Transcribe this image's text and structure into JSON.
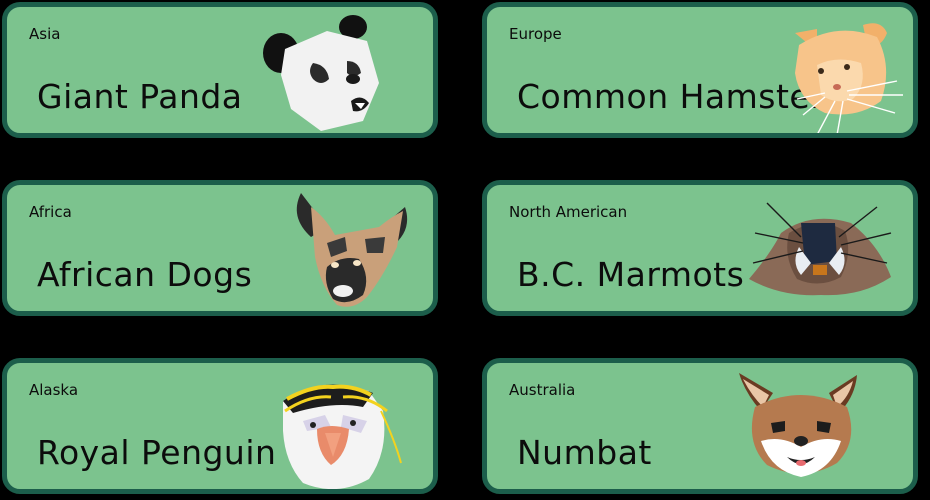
{
  "cards": [
    {
      "region": "Asia",
      "name": "Giant Panda",
      "icon": "panda-icon"
    },
    {
      "region": "Europe",
      "name": "Common Hamster",
      "icon": "hamster-icon"
    },
    {
      "region": "Africa",
      "name": "African Dogs",
      "icon": "african-wild-dog-icon"
    },
    {
      "region": "North American",
      "name": "B.C. Marmots",
      "icon": "marmot-icon"
    },
    {
      "region": "Alaska",
      "name": "Royal Penguin",
      "icon": "penguin-icon"
    },
    {
      "region": "Australia",
      "name": "Numbat",
      "icon": "numbat-icon"
    }
  ],
  "colors": {
    "card_fill": "#7cc38e",
    "card_border": "#1c5e4b",
    "background": "#000000"
  }
}
